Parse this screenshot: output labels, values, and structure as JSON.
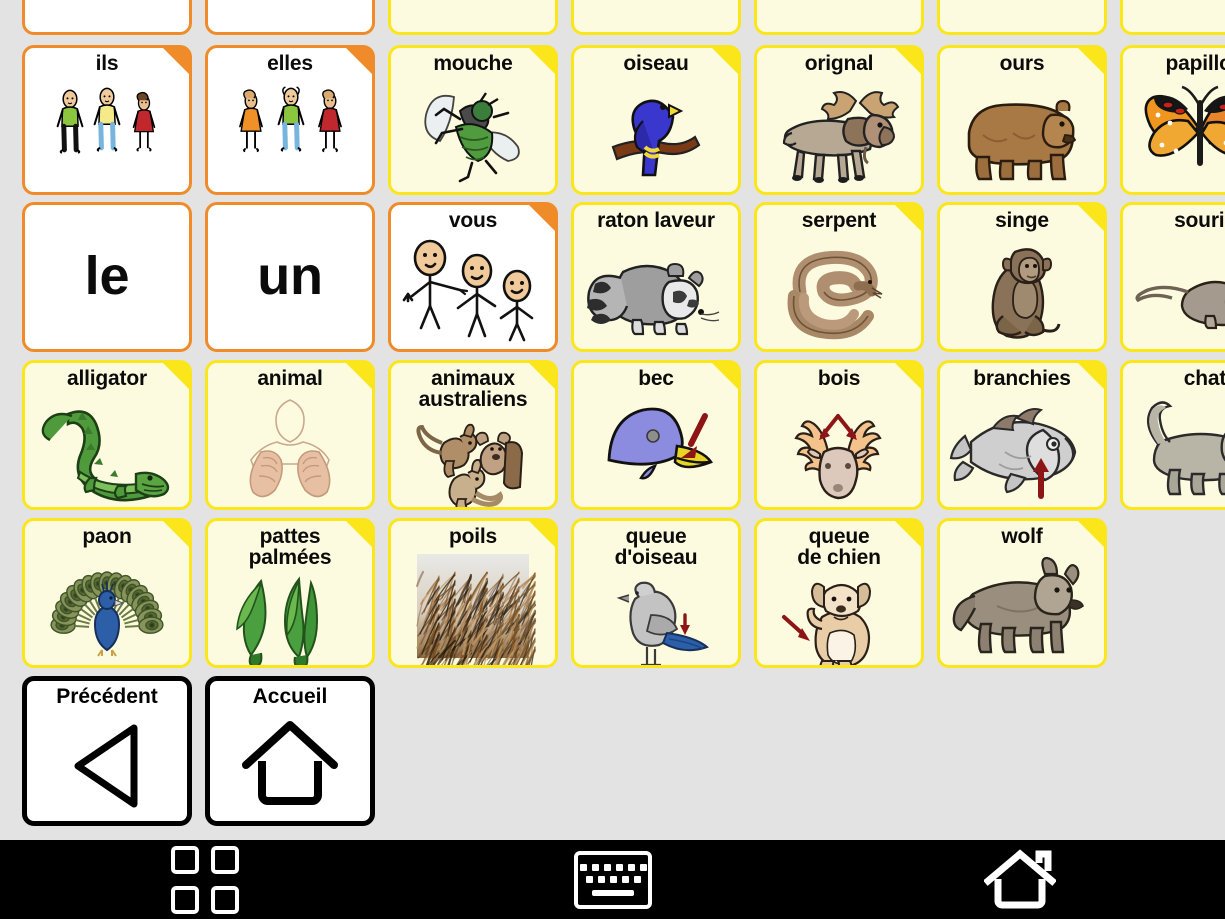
{
  "app": {
    "type": "aac-communication-board",
    "language": "fr",
    "background_color": "#e3e3e3",
    "orange_border_color": "#ef8b28",
    "yellow_border_color": "#fbe61b",
    "orange_fill_color": "#ffffff",
    "yellow_fill_color": "#fdfbdf"
  },
  "rows": [
    {
      "index": 0,
      "clipped": "top",
      "cells": [
        {
          "label": "",
          "color": "orange",
          "fold": false,
          "art": "hand-partial"
        },
        {
          "label": "",
          "color": "orange",
          "fold": false,
          "art": "pointing-partial"
        },
        {
          "label": "",
          "color": "yellow",
          "fold": false,
          "art": "paws-partial"
        },
        {
          "label": "",
          "color": "yellow",
          "fold": false,
          "art": "hooves-partial"
        },
        {
          "label": "",
          "color": "yellow",
          "fold": false,
          "art": "tail-partial"
        },
        {
          "label": "",
          "color": "yellow",
          "fold": false,
          "art": "legs-partial"
        },
        {
          "label": "",
          "color": "yellow",
          "fold": false,
          "art": "fins-partial"
        }
      ]
    },
    {
      "index": 1,
      "cells": [
        {
          "label": "ils",
          "color": "orange",
          "fold": true,
          "art": "three-people-mixed"
        },
        {
          "label": "elles",
          "color": "orange",
          "fold": true,
          "art": "three-women"
        },
        {
          "label": "mouche",
          "color": "yellow",
          "fold": true,
          "art": "fly"
        },
        {
          "label": "oiseau",
          "color": "yellow",
          "fold": true,
          "art": "blue-bird-on-branch"
        },
        {
          "label": "orignal",
          "color": "yellow",
          "fold": true,
          "art": "moose"
        },
        {
          "label": "ours",
          "color": "yellow",
          "fold": true,
          "art": "bear"
        },
        {
          "label": "papillon",
          "color": "yellow",
          "fold": true,
          "art": "butterfly",
          "clipped": "right"
        }
      ]
    },
    {
      "index": 2,
      "cells": [
        {
          "label": "le",
          "color": "orange",
          "fold": false,
          "art": "none",
          "word_only": true
        },
        {
          "label": "un",
          "color": "orange",
          "fold": false,
          "art": "none",
          "word_only": true
        },
        {
          "label": "vous",
          "color": "orange",
          "fold": true,
          "art": "stick-figures-pointing"
        },
        {
          "label": "raton laveur",
          "color": "yellow",
          "fold": false,
          "art": "raccoon"
        },
        {
          "label": "serpent",
          "color": "yellow",
          "fold": true,
          "art": "snake-coiled"
        },
        {
          "label": "singe",
          "color": "yellow",
          "fold": true,
          "art": "monkey-sitting"
        },
        {
          "label": "souris",
          "color": "yellow",
          "fold": true,
          "art": "mouse",
          "clipped": "right"
        }
      ]
    },
    {
      "index": 3,
      "cells": [
        {
          "label": "alligator",
          "color": "yellow",
          "fold": true,
          "art": "alligator"
        },
        {
          "label": "animal",
          "color": "yellow",
          "fold": true,
          "art": "sign-language-animal"
        },
        {
          "label": "animaux\naustraliens",
          "color": "yellow",
          "fold": true,
          "art": "kangaroo-koala"
        },
        {
          "label": "bec",
          "color": "yellow",
          "fold": true,
          "art": "bird-head-beak-arrow"
        },
        {
          "label": "bois",
          "color": "yellow",
          "fold": true,
          "art": "deer-antlers-arrows"
        },
        {
          "label": "branchies",
          "color": "yellow",
          "fold": true,
          "art": "fish-gills-arrow"
        },
        {
          "label": "chat",
          "color": "yellow",
          "fold": true,
          "art": "cat",
          "clipped": "right"
        }
      ]
    },
    {
      "index": 4,
      "cells": [
        {
          "label": "paon",
          "color": "yellow",
          "fold": true,
          "art": "peacock"
        },
        {
          "label": "pattes\npalmées",
          "color": "yellow",
          "fold": true,
          "art": "webbed-feet"
        },
        {
          "label": "poils",
          "color": "yellow",
          "fold": true,
          "art": "fur-photo"
        },
        {
          "label": "queue\nd'oiseau",
          "color": "yellow",
          "fold": false,
          "art": "bird-tail-arrow"
        },
        {
          "label": "queue\nde chien",
          "color": "yellow",
          "fold": true,
          "art": "dog-tail-arrow"
        },
        {
          "label": "wolf",
          "color": "yellow",
          "fold": true,
          "art": "wolf"
        }
      ]
    }
  ],
  "nav": {
    "back": {
      "label": "Précédent",
      "icon": "left-triangle-icon"
    },
    "home": {
      "label": "Accueil",
      "icon": "house-outline-icon"
    }
  },
  "system_bar": {
    "background_color": "#000000",
    "buttons": [
      {
        "name": "recent-apps",
        "icon": "four-squares-icon"
      },
      {
        "name": "keyboard",
        "icon": "keyboard-icon"
      },
      {
        "name": "home",
        "icon": "home-icon"
      }
    ]
  }
}
